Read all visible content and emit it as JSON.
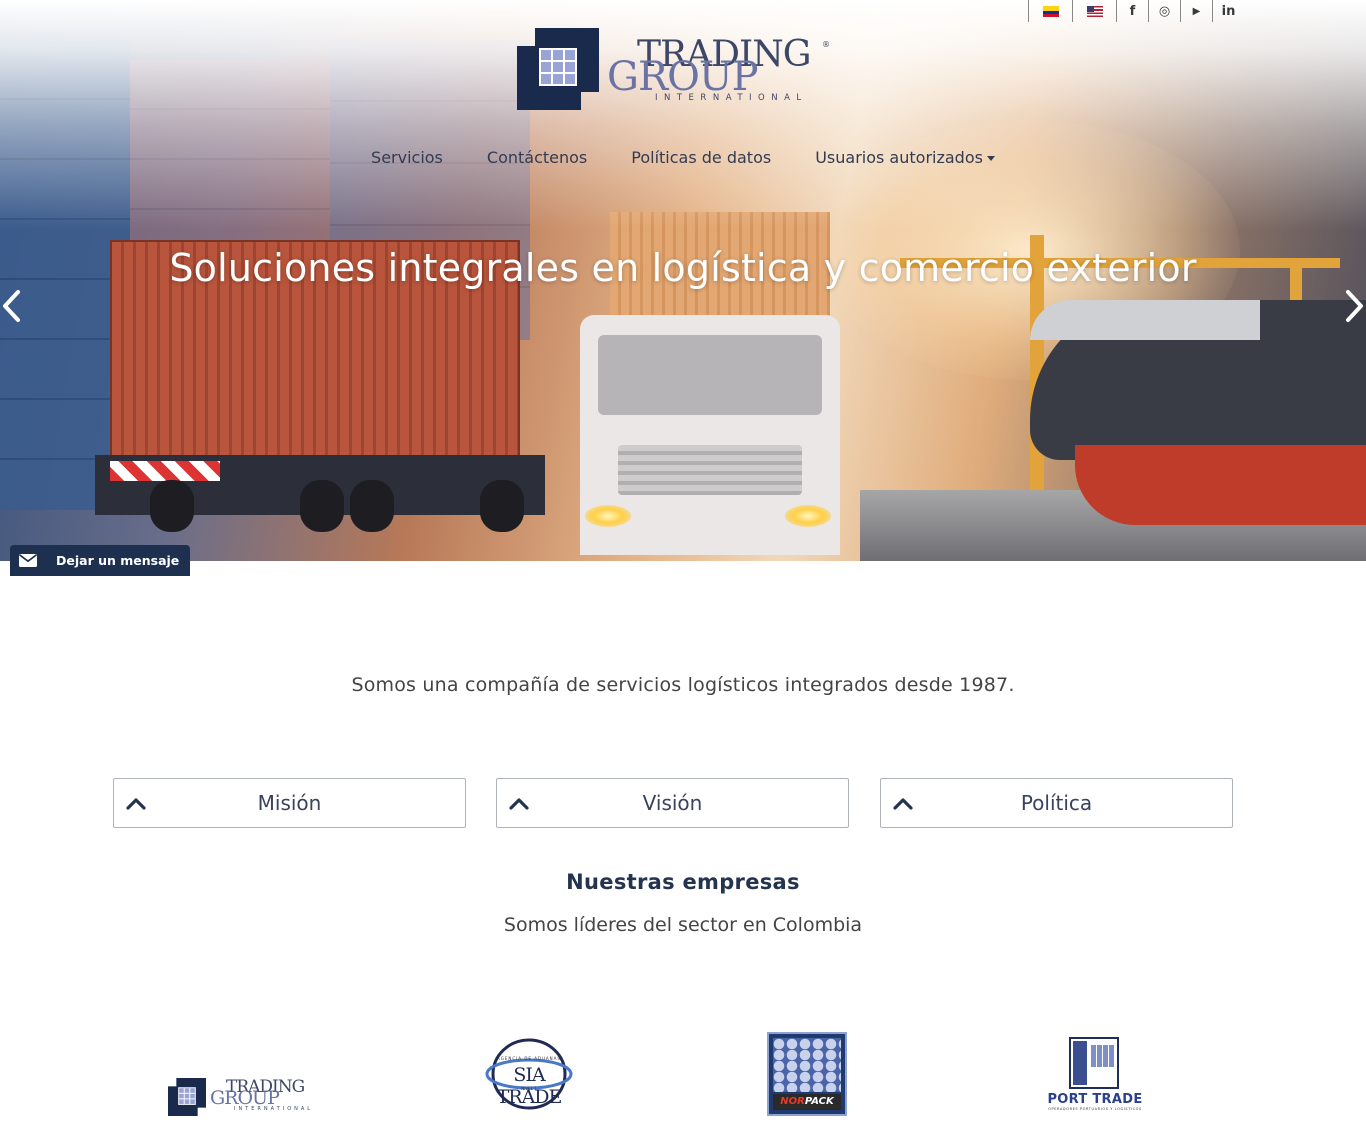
{
  "topbar": {
    "items": [
      {
        "name": "flag-colombia-icon"
      },
      {
        "name": "flag-usa-icon"
      },
      {
        "name": "facebook-icon",
        "glyph": "f"
      },
      {
        "name": "instagram-icon",
        "glyph": "◎"
      },
      {
        "name": "youtube-icon",
        "glyph": "▶"
      },
      {
        "name": "linkedin-icon",
        "glyph": "in"
      }
    ]
  },
  "logo": {
    "line1": "TRADING",
    "line2": "GROUP",
    "line3": "INTERNATIONAL",
    "reg": "®"
  },
  "nav": {
    "items": [
      "Servicios",
      "Contáctenos",
      "Políticas de datos",
      "Usuarios autorizados"
    ]
  },
  "hero": {
    "title": "Soluciones integrales en logística y comercio exterior"
  },
  "message_tab": {
    "label": "Dejar un mensaje"
  },
  "intro": {
    "text": "Somos una compañía de servicios logísticos integrados desde 1987."
  },
  "accordions": [
    "Misión",
    "Visión",
    "Política"
  ],
  "companies": {
    "title": "Nuestras empresas",
    "subtitle": "Somos líderes del sector en Colombia",
    "brands": {
      "trading_group": {
        "line1": "TRADING",
        "line2": "GROUP",
        "line3": "INTERNATIONAL",
        "reg": "®"
      },
      "sia_trade": {
        "name": "SIA TRADE",
        "top": "AGENCIA DE ADUANAS",
        "bottom": "NIVEL 1"
      },
      "norpack": {
        "prefix": "NOR",
        "suffix": "PACK"
      },
      "port_trade": {
        "name": "PORT TRADE",
        "sub": "OPERADORES PORTUARIOS Y LOGISTICOS"
      }
    }
  },
  "colors": {
    "brand_navy": "#1e3050",
    "text_dark": "#24344f",
    "logo_violet": "#6a73a3"
  }
}
